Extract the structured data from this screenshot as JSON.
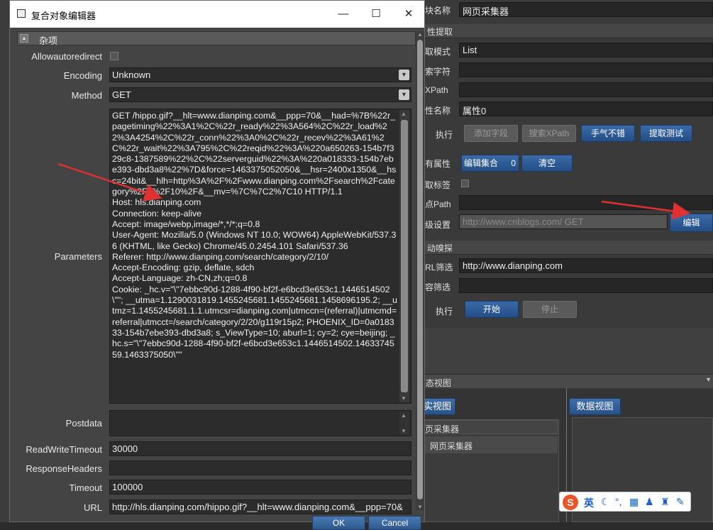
{
  "bg": {
    "module_name_label": "块名称",
    "module_name_value": "网页采集器",
    "section_extract": "性提取",
    "extract_mode_label": "取模式",
    "extract_mode_value": "List",
    "search_string_label": "索字符",
    "xpath_label": "XPath",
    "attr_name_label": "性名称",
    "attr_name_value": "属性0",
    "exec_label": "执行",
    "btn_add_field": "添加字段",
    "btn_search_xpath": "搜索XPath",
    "btn_luck": "手气不错",
    "btn_extract_test": "提取测试",
    "has_attr_label": "有属性",
    "btn_edit_collection": "编辑集合",
    "collection_count": "0",
    "btn_clear": "清空",
    "extract_tag_label": "取标签",
    "root_path_label": "点Path",
    "advanced_label": "级设置",
    "advanced_value": "http://www.cnblogs.com/ GET",
    "btn_edit": "编辑",
    "section_sniff": "动嗅探",
    "url_filter_label": "RL筛选",
    "url_filter_value": "http://www.dianping.com",
    "content_filter_label": "容筛选",
    "exec2_label": "执行",
    "btn_start": "开始",
    "btn_stop": "停止",
    "section_view": "态视图",
    "tab_tree_view": "实视图",
    "tab_data_view": "数据视图",
    "tree_item1": "页采集器",
    "tree_item2": "网页采集器"
  },
  "dialog": {
    "title": "复合对象编辑器",
    "section": "杂项",
    "props": {
      "allowautoredirect_label": "Allowautoredirect",
      "encoding_label": "Encoding",
      "encoding_value": "Unknown",
      "method_label": "Method",
      "method_value": "GET",
      "parameters_label": "Parameters",
      "parameters_value": "GET /hippo.gif?__hlt=www.dianping.com&__ppp=70&__had=%7B%22r_pagetiming%22%3A1%2C%22r_ready%22%3A564%2C%22r_load%22%3A4254%2C%22r_conn%22%3A0%2C%22r_recev%22%3A61%2C%22r_wait%22%3A795%2C%22reqid%22%3A%220a650263-154b7f329c8-1387589%22%2C%22serverguid%22%3A%220a018333-154b7ebe393-dbd3a8%22%7D&force=1463375052050&__hsr=2400x1350&__hsc=24bit&__hlh=http%3A%2F%2Fwww.dianping.com%2Fsearch%2Fcategory%2F2%2F10%2F&__mv=%7C%7C2%7C10 HTTP/1.1\nHost: hls.dianping.com\nConnection: keep-alive\nAccept: image/webp,image/*,*/*;q=0.8\nUser-Agent: Mozilla/5.0 (Windows NT 10.0; WOW64) AppleWebKit/537.36 (KHTML, like Gecko) Chrome/45.0.2454.101 Safari/537.36\nReferer: http://www.dianping.com/search/category/2/10/\nAccept-Encoding: gzip, deflate, sdch\nAccept-Language: zh-CN,zh;q=0.8\nCookie: _hc.v=\"\\\"7ebbc90d-1288-4f90-bf2f-e6bcd3e653c1.1446514502\\\"\"; __utma=1.1290031819.1455245681.1455245681.1458696195.2; __utmz=1.1455245681.1.1.utmcsr=dianping.com|utmccn=(referral)|utmcmd=referral|utmcct=/search/category/2/20/g119r15p2; PHOENIX_ID=0a018333-154b7ebe393-dbd3a8; s_ViewType=10; aburl=1; cy=2; cye=beijing; _hc.s=\"\\\"7ebbc90d-1288-4f90-bf2f-e6bcd3e653c1.1446514502.1463374559.1463375050\\\"\"",
      "postdata_label": "Postdata",
      "postdata_value": "",
      "readwritetimeout_label": "ReadWriteTimeout",
      "readwritetimeout_value": "30000",
      "responseheaders_label": "ResponseHeaders",
      "responseheaders_value": "",
      "timeout_label": "Timeout",
      "timeout_value": "100000",
      "url_label": "URL",
      "url_value": "http://hls.dianping.com/hippo.gif?__hlt=www.dianping.com&__ppp=70&"
    },
    "ok_label": "OK",
    "cancel_label": "Cancel"
  },
  "ime": {
    "lang": "英"
  },
  "colors": {
    "accent_blue": "#2c5a90",
    "annotation_red": "#e03030"
  }
}
